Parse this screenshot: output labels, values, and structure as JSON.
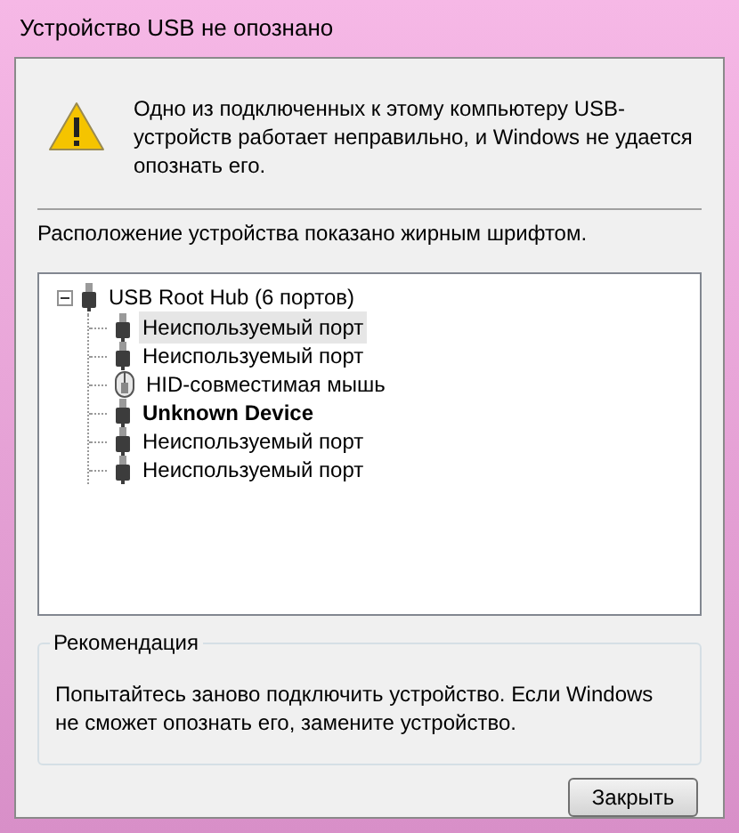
{
  "window": {
    "title": "Устройство USB не опознано"
  },
  "message": "Одно из подключенных к этому компьютеру USB-устройств работает неправильно, и Windows не удается опознать его.",
  "hint": "Расположение устройства показано жирным шрифтом.",
  "tree": [
    {
      "label": "USB Root Hub (6 портов)",
      "kind": "usb",
      "bold": false,
      "selected": false,
      "expanded": true,
      "children": [
        {
          "label": "Неиспользуемый порт",
          "kind": "usb",
          "bold": false,
          "selected": true
        },
        {
          "label": "Неиспользуемый порт",
          "kind": "usb",
          "bold": false,
          "selected": false
        },
        {
          "label": "HID-совместимая мышь",
          "kind": "mouse",
          "bold": false,
          "selected": false
        },
        {
          "label": "Unknown Device",
          "kind": "usb",
          "bold": true,
          "selected": false
        },
        {
          "label": "Неиспользуемый порт",
          "kind": "usb",
          "bold": false,
          "selected": false
        },
        {
          "label": "Неиспользуемый порт",
          "kind": "usb",
          "bold": false,
          "selected": false
        }
      ]
    }
  ],
  "recommendation": {
    "title": "Рекомендация",
    "text": "Попытайтесь заново подключить устройство. Если Windows не сможет опознать его, замените устройство."
  },
  "buttons": [
    "Закрыть"
  ]
}
